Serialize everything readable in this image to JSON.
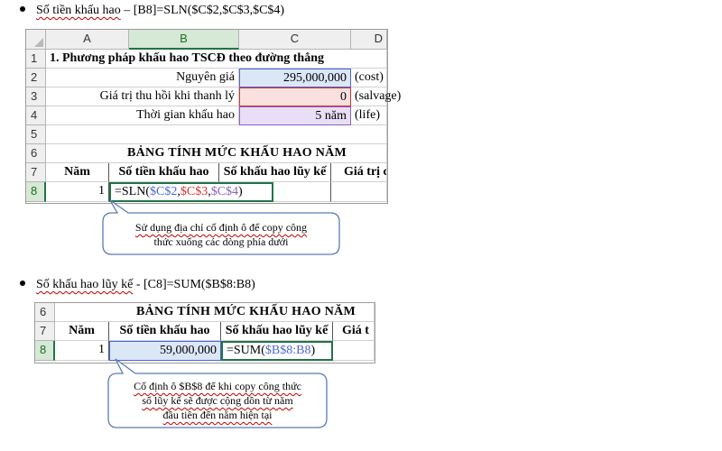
{
  "bullet1": {
    "text_underlined": "Số tiền khấu hao",
    "text_rest": " – [B8]=SLN($C$2,$C$3,$C$4)"
  },
  "sheet1": {
    "columns": [
      "A",
      "B",
      "C",
      "D"
    ],
    "rows": [
      "1",
      "2",
      "3",
      "4",
      "5",
      "6",
      "7",
      "8"
    ],
    "r1_title": "1. Phương pháp khấu hao TSCĐ theo đường thẳng",
    "r2_label": "Nguyên giá",
    "r2_value": "295,000,000",
    "r2_note": "(cost)",
    "r3_label": "Giá trị thu hồi khi thanh lý",
    "r3_value": "0",
    "r3_note": "(salvage)",
    "r4_label": "Thời gian khấu hao",
    "r4_value": "5 năm",
    "r4_note": "(life)",
    "r6_title": "BẢNG TÍNH MỨC KHẤU HAO NĂM",
    "r7_headers": [
      "Năm",
      "Số tiền khấu hao",
      "Số khấu hao lũy kế",
      "Giá trị c"
    ],
    "r8_year": "1",
    "r8_formula_prefix": "=SLN(",
    "r8_ref1": "$C$2",
    "r8_comma1": ",",
    "r8_ref2": "$C$3",
    "r8_comma2": ",",
    "r8_ref3": "$C$4",
    "r8_formula_suffix": ")"
  },
  "callout1": {
    "line1": "Sử dụng địa chỉ cố định ô để copy công",
    "line2": "thức xuống các dòng phía dưới"
  },
  "bullet2": {
    "text_underlined": "Số khấu hao lũy kế",
    "text_rest": " - [C8]=SUM($B$8:B8)"
  },
  "sheet2": {
    "rows": [
      "6",
      "7",
      "8"
    ],
    "r6_title": "BẢNG TÍNH MỨC KHẤU HAO NĂM",
    "r7_headers": [
      "Năm",
      "Số tiền khấu hao",
      "Số khấu hao lũy kế",
      "Giá t"
    ],
    "r8_year": "1",
    "r8_amount": "59,000,000",
    "r8_formula_prefix": "=SUM(",
    "r8_ref": "$B$8:B8",
    "r8_formula_suffix": ")"
  },
  "callout2": {
    "line1": "Cố định ô $B$8 để khi copy công thức",
    "line2": "số lũy kế sẽ được cộng dồn từ năm",
    "line3": "đầu tiên đến năm hiện tại"
  },
  "colors": {
    "ref_blue": "#4a66d8",
    "ref_red": "#d8342c",
    "ref_purple": "#8a60c0",
    "highlight_blue": "#dbe6f7",
    "highlight_red": "#fbe0e0",
    "highlight_purple": "#e8def5",
    "excel_green": "#217346"
  }
}
